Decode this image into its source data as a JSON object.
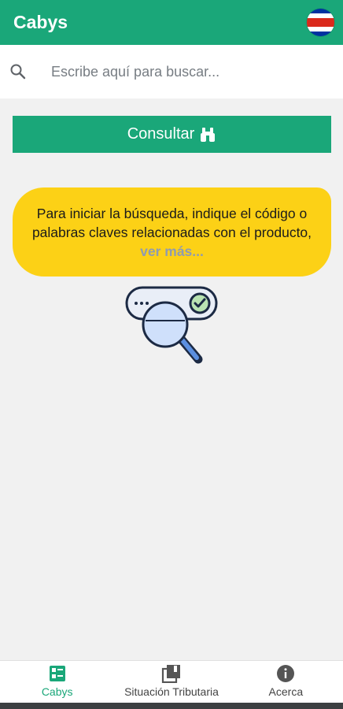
{
  "app": {
    "title": "Cabys"
  },
  "flag": {
    "name": "costa-rica-flag",
    "colors": [
      "#0032a0",
      "#ffffff",
      "#da291c",
      "#ffffff",
      "#0032a0"
    ]
  },
  "search": {
    "placeholder": "Escribe aquí para buscar...",
    "value": ""
  },
  "consult_button": {
    "label": "Consultar",
    "icon": "binoculars-icon"
  },
  "info": {
    "text": "Para iniciar la búsqueda, indique el código o palabras claves relacionadas con el producto,",
    "link": "ver más..."
  },
  "bottom_nav": {
    "items": [
      {
        "label": "Cabys",
        "icon": "list-icon",
        "active": true
      },
      {
        "label": "Situación Tributaria",
        "icon": "book-icon",
        "active": false
      },
      {
        "label": "Acerca",
        "icon": "info-icon",
        "active": false
      }
    ]
  },
  "colors": {
    "primary": "#1aa779",
    "bubble": "#fcd116",
    "background": "#f1f1f1"
  }
}
